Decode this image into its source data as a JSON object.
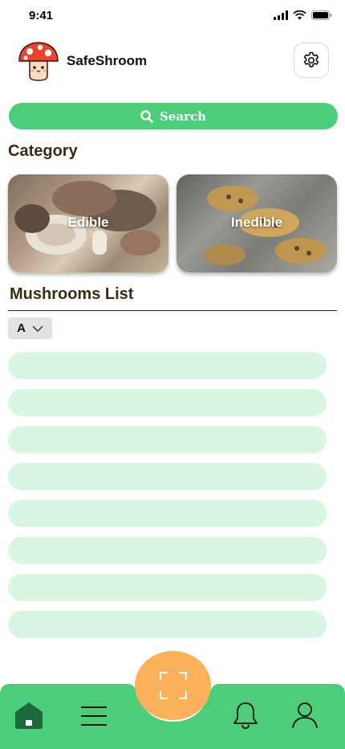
{
  "status_bar": {
    "time": "9:41"
  },
  "header": {
    "app_name": "SafeShroom"
  },
  "search": {
    "label": "Search"
  },
  "category": {
    "title": "Category",
    "cards": [
      {
        "label": "Edible"
      },
      {
        "label": "Inedible"
      }
    ]
  },
  "mushrooms_list": {
    "title": "Mushrooms List",
    "sort_value": "A",
    "item_count": 8
  },
  "colors": {
    "accent_green": "#4ccd79",
    "list_item_bg": "#d9f6e2",
    "scan_button": "#fbb05a",
    "section_title": "#3b2b12",
    "home_active": "#1c6a3b"
  },
  "icons": {
    "status": [
      "signal-icon",
      "wifi-icon",
      "battery-icon"
    ],
    "header": [
      "mushroom-logo-icon",
      "gear-icon"
    ],
    "search": "search-icon",
    "sort": "chevron-down-icon",
    "nav": [
      "home-icon",
      "menu-icon",
      "scan-icon",
      "bell-icon",
      "user-icon"
    ]
  }
}
